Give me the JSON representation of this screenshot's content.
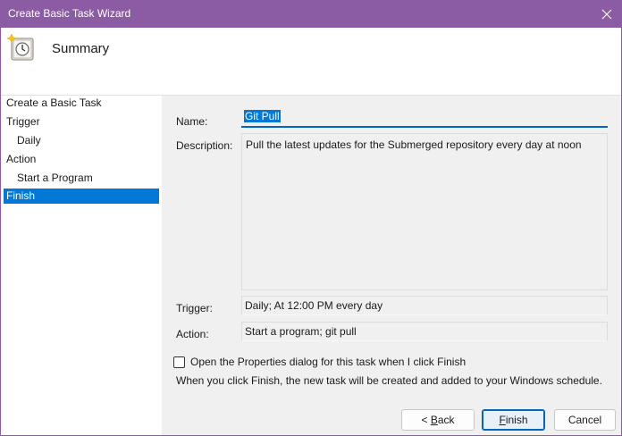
{
  "window": {
    "title": "Create Basic Task Wizard"
  },
  "header": {
    "title": "Summary",
    "icon": "task-scheduler-clock-icon"
  },
  "nav": {
    "items": [
      {
        "label": "Create a Basic Task"
      },
      {
        "label": "Trigger"
      },
      {
        "label": "Daily"
      },
      {
        "label": "Action"
      },
      {
        "label": "Start a Program"
      },
      {
        "label": "Finish"
      }
    ]
  },
  "summary": {
    "name_label": "Name:",
    "name_value": "Git Pull",
    "description_label": "Description:",
    "description_value": "Pull the latest updates for the Submerged repository every day at noon",
    "trigger_label": "Trigger:",
    "trigger_value": "Daily; At 12:00 PM every day",
    "action_label": "Action:",
    "action_value": "Start a program; git pull"
  },
  "open_properties": {
    "label": "Open the Properties dialog for this task when I click Finish",
    "checked": false
  },
  "info_text": "When you click Finish, the new task will be created and added to your Windows schedule.",
  "buttons": {
    "back_prefix": "< ",
    "back_mnemonic": "B",
    "back_rest": "ack",
    "finish_mnemonic": "F",
    "finish_rest": "inish",
    "cancel": "Cancel"
  },
  "colors": {
    "titlebar": "#8b5ca3",
    "selection": "#0078d7",
    "accent": "#0067c0"
  }
}
